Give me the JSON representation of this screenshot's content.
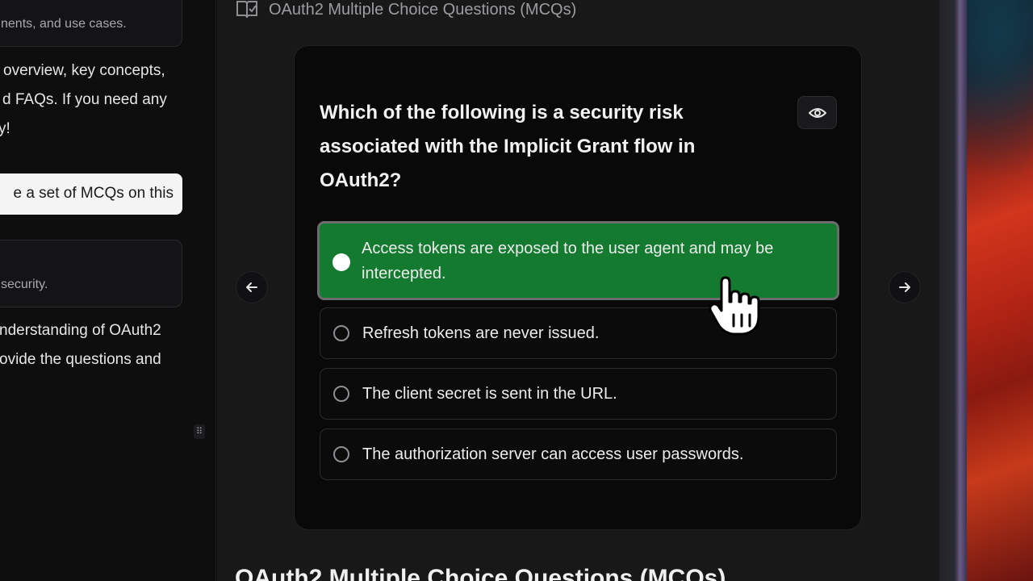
{
  "chat": {
    "card1_text": "nents, and use cases.",
    "msg1_lines": [
      "overview, key concepts,",
      "d FAQs. If you need any",
      "y!"
    ],
    "user_message": "e a set of MCQs on this",
    "card2_text": "security.",
    "msg2_lines": [
      "nderstanding of OAuth2",
      "ovide the questions and"
    ]
  },
  "document": {
    "title": "OAuth2 Multiple Choice Questions (MCQs)",
    "section_heading": "OAuth2 Multiple Choice Questions (MCQs)"
  },
  "quiz": {
    "question": "Which of the following is a security risk associated with the Implicit Grant flow in OAuth2?",
    "options": [
      {
        "line1": "Access tokens are exposed to the user agent and may be",
        "line2": "intercepted.",
        "selected": true
      },
      {
        "line1": "Refresh tokens are never issued.",
        "selected": false
      },
      {
        "line1": "The client secret is sent in the URL.",
        "selected": false
      },
      {
        "line1": "The authorization server can access user passwords.",
        "selected": false
      }
    ],
    "selected_color": "#137a2f"
  },
  "icons": {
    "doc": "quiz-document-icon",
    "reveal": "eye-icon",
    "prev": "arrow-left-icon",
    "next": "arrow-right-icon",
    "drag": "drag-handle-icon",
    "cursor": "hand-pointer-icon"
  }
}
